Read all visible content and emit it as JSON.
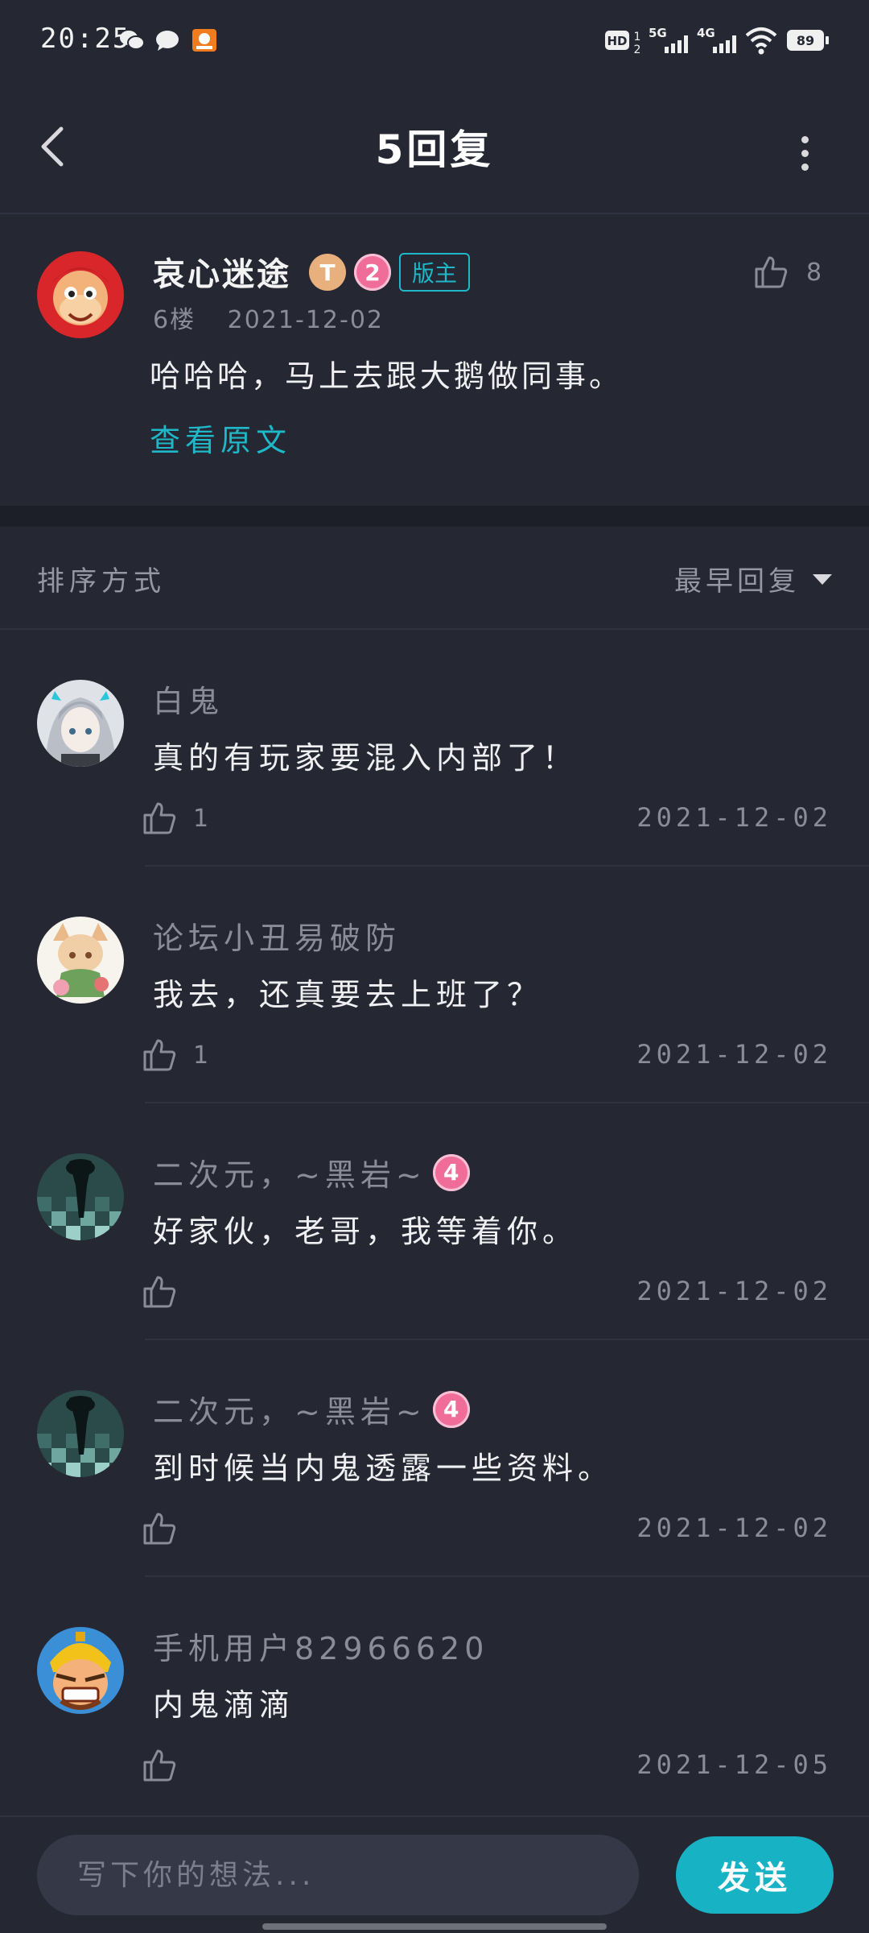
{
  "status_bar": {
    "time": "20:25",
    "battery": "89"
  },
  "header": {
    "title": "5回复"
  },
  "post": {
    "author": "哀心迷途",
    "badge_letter": "T",
    "level": "2",
    "role_badge": "版主",
    "floor": "6楼",
    "date": "2021-12-02",
    "likes": "8",
    "content": "哈哈哈，马上去跟大鹅做同事。",
    "view_original": "查看原文"
  },
  "sort": {
    "label": "排序方式",
    "value": "最早回复"
  },
  "replies": [
    {
      "name": "白鬼",
      "text": "真的有玩家要混入内部了！",
      "likes": "1",
      "date": "2021-12-02"
    },
    {
      "name": "论坛小丑易破防",
      "text": "我去，还真要去上班了？",
      "likes": "1",
      "date": "2021-12-02"
    },
    {
      "name": "二次元，~黑岩~",
      "level": "4",
      "text": "好家伙，老哥，我等着你。",
      "likes": "",
      "date": "2021-12-02"
    },
    {
      "name": "二次元，~黑岩~",
      "level": "4",
      "text": "到时候当内鬼透露一些资料。",
      "likes": "",
      "date": "2021-12-02"
    },
    {
      "name": "手机用户82966620",
      "text": "内鬼滴滴",
      "likes": "",
      "date": "2021-12-05"
    }
  ],
  "composer": {
    "placeholder": "写下你的想法...",
    "send_label": "发送"
  },
  "colors": {
    "background": "#252733",
    "accent": "#17b3c5",
    "level_badge": "#f06d9a"
  }
}
